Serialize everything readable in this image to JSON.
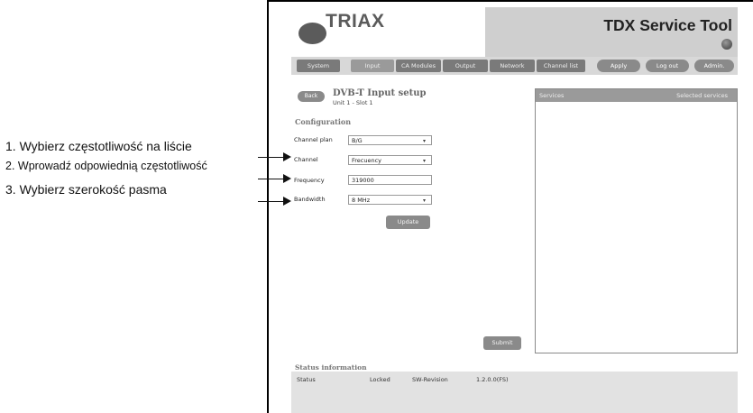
{
  "annotations": [
    {
      "text": "1. Wybierz częstotliwość na liście"
    },
    {
      "text": "2. Wprowadź odpowiednią częstotliwość"
    },
    {
      "text": "3. Wybierz szerokość pasma"
    }
  ],
  "header": {
    "logo_text": "TRIAX",
    "app_title": "TDX Service Tool"
  },
  "nav": {
    "tabs": [
      "System",
      "Input",
      "CA Modules",
      "Output",
      "Network",
      "Channel list"
    ],
    "active_tab": "Input",
    "buttons": [
      "Apply",
      "Log out",
      "Admin."
    ]
  },
  "page": {
    "back_label": "Back",
    "title": "DVB-T Input setup",
    "subtitle": "Unit 1 - Slot 1",
    "section_title": "Configuration"
  },
  "form": {
    "channel_plan_label": "Channel plan",
    "channel_plan_value": "B/G",
    "channel_label": "Channel",
    "channel_value": "Frecuency",
    "frequency_label": "Frequency",
    "frequency_value": "319000",
    "bandwidth_label": "Bandwidth",
    "bandwidth_value": "8 MHz",
    "update_label": "Update"
  },
  "services": {
    "col1": "Services",
    "col2": "Selected services"
  },
  "submit_label": "Submit",
  "status": {
    "title": "Status information",
    "status_label": "Status",
    "status_value": "Locked",
    "sw_label": "SW-Revision",
    "sw_value": "1.2.0.0(FS)"
  },
  "icons": {
    "dropdown": "chevron-down-icon",
    "lamp": "status-lamp-icon"
  }
}
